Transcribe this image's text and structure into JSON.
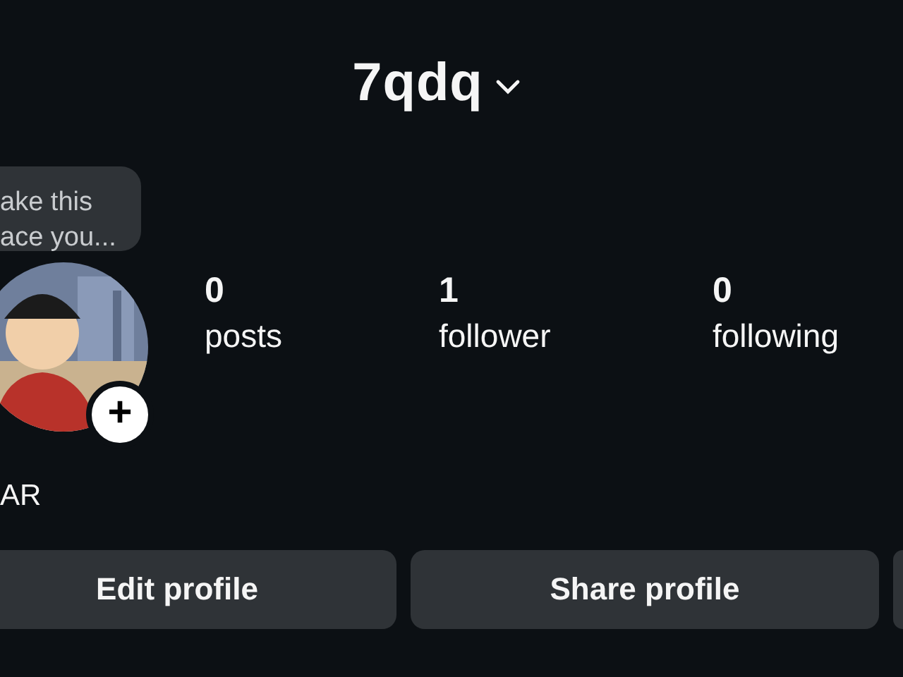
{
  "header": {
    "username": "7qdq"
  },
  "profile": {
    "tooltip": "ake this\nace you...",
    "add_badge": "+",
    "name": "AR"
  },
  "stats": [
    {
      "count": "0",
      "label": "posts"
    },
    {
      "count": "1",
      "label": "follower"
    },
    {
      "count": "0",
      "label": "following"
    }
  ],
  "buttons": [
    {
      "kind": "labeled",
      "label": "Edit profile"
    },
    {
      "kind": "labeled",
      "label": "Share profile"
    },
    {
      "kind": "edge"
    }
  ]
}
